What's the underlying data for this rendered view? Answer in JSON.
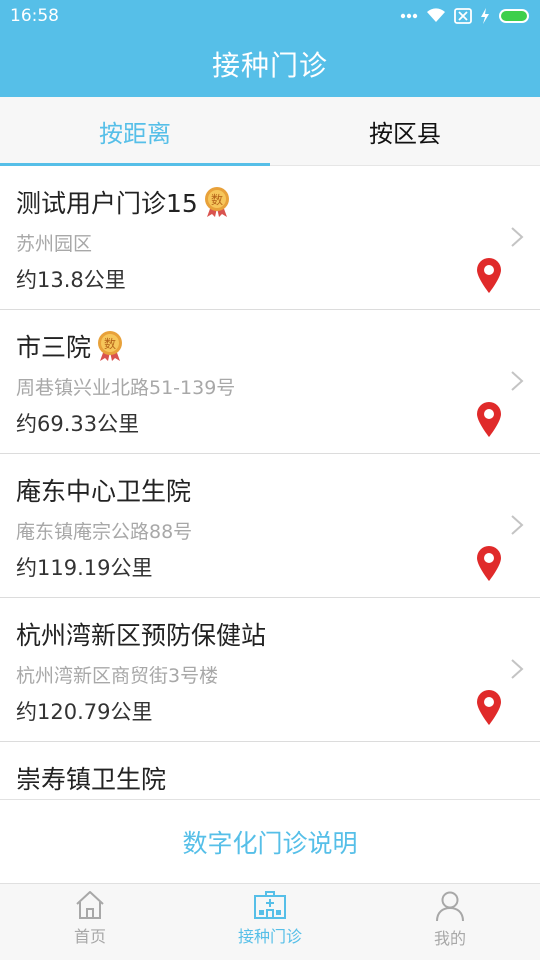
{
  "status_bar": {
    "time": "16:58"
  },
  "header": {
    "title": "接种门诊"
  },
  "tabs": [
    {
      "label": "按距离",
      "active": true
    },
    {
      "label": "按区县",
      "active": false
    }
  ],
  "clinics": [
    {
      "name": "测试用户门诊15",
      "badge": "数",
      "address": "苏州园区",
      "distance": "约13.8公里"
    },
    {
      "name": "市三院",
      "badge": "数",
      "address": "周巷镇兴业北路51-139号",
      "distance": "约69.33公里"
    },
    {
      "name": "庵东中心卫生院",
      "badge": "",
      "address": "庵东镇庵宗公路88号",
      "distance": "约119.19公里"
    },
    {
      "name": "杭州湾新区预防保健站",
      "badge": "",
      "address": "杭州湾新区商贸街3号楼",
      "distance": "约120.79公里"
    },
    {
      "name": "崇寿镇卫生院",
      "badge": "",
      "address": "",
      "distance": ""
    }
  ],
  "info_link": {
    "label": "数字化门诊说明"
  },
  "bottom_nav": [
    {
      "label": "首页",
      "icon": "home-icon",
      "active": false
    },
    {
      "label": "接种门诊",
      "icon": "hospital-icon",
      "active": true
    },
    {
      "label": "我的",
      "icon": "person-icon",
      "active": false
    }
  ],
  "colors": {
    "primary": "#56bfe8",
    "pin_red": "#e02a2a",
    "badge_gold": "#e8a13a"
  }
}
